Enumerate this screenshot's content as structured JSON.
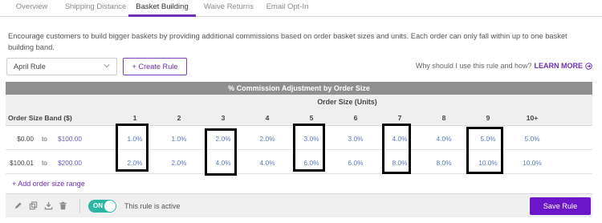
{
  "tabs": [
    {
      "label": "Overview",
      "active": false
    },
    {
      "label": "Shipping Distance",
      "active": false
    },
    {
      "label": "Basket Building",
      "active": true
    },
    {
      "label": "Waive Returns",
      "active": false
    },
    {
      "label": "Email Opt-In",
      "active": false
    }
  ],
  "description": "Encourage customers to build bigger baskets by providing additional commissions based on order basket sizes and units. Each order can only fall within up to one basket building band.",
  "rule_select": {
    "value": "April Rule"
  },
  "create_rule_label": "+ Create Rule",
  "help": {
    "question": "Why should I use this rule and how?",
    "link": "LEARN MORE"
  },
  "table": {
    "title": "% Commission Adjustment by Order Size",
    "units_header": "Order Size (Units)",
    "band_header": "Order Size Band ($)",
    "columns": [
      "1",
      "2",
      "3",
      "4",
      "5",
      "6",
      "7",
      "8",
      "9",
      "10+"
    ],
    "rows": [
      {
        "from": "$0.00",
        "to_label": "to",
        "to": "$100.00",
        "values": [
          "1.0%",
          "1.0%",
          "2.0%",
          "2.0%",
          "3.0%",
          "3.0%",
          "4.0%",
          "4.0%",
          "5.0%",
          "5.0%"
        ]
      },
      {
        "from": "$100.01",
        "to_label": "to",
        "to": "$200.00",
        "values": [
          "2.0%",
          "2.0%",
          "4.0%",
          "4.0%",
          "6.0%",
          "6.0%",
          "8.0%",
          "8.0%",
          "10.0%",
          "10.0%"
        ]
      }
    ]
  },
  "add_range_label": "+ Add order size range",
  "footer": {
    "toggle_label": "ON",
    "status": "This rule is active",
    "save_label": "Save Rule"
  },
  "colors": {
    "accent": "#6b17c9",
    "toggle": "#2bb5a3",
    "header": "#8f8f8f"
  }
}
